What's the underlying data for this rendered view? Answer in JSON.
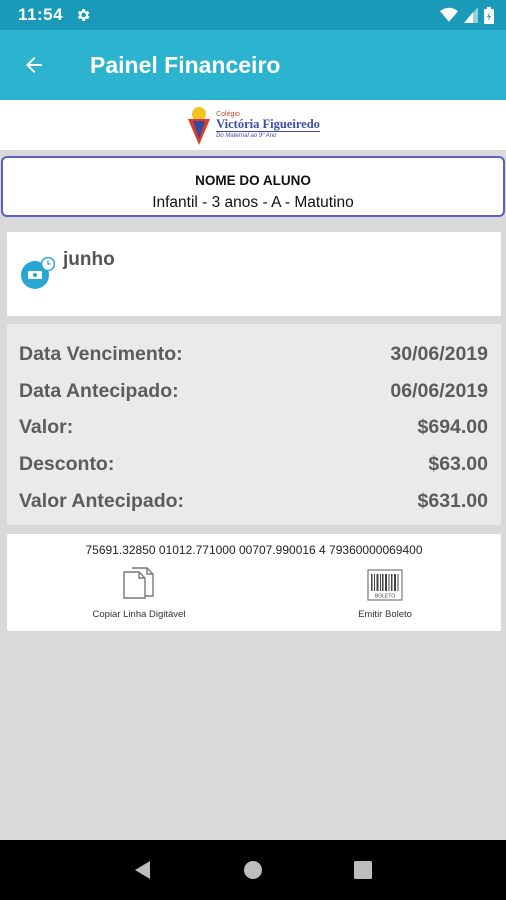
{
  "status_bar": {
    "time": "11:54",
    "icons": [
      "settings-gear-icon",
      "wifi-icon",
      "signal-icon",
      "battery-icon"
    ]
  },
  "app_bar": {
    "title": "Painel Financeiro",
    "back_icon": "arrow-left-icon",
    "color": "#2bb3cf"
  },
  "logo": {
    "small": "Colégio",
    "name": "Victória Figueiredo",
    "sub": "Do Maternal ao 9º Ano"
  },
  "student": {
    "name": "NOME DO ALUNO",
    "class": "Infantil - 3 anos - A - Matutino"
  },
  "month": {
    "label": "junho",
    "icon": "payment-clock-icon"
  },
  "details": [
    {
      "label": "Data Vencimento:",
      "value": "30/06/2019"
    },
    {
      "label": "Data Antecipado:",
      "value": "06/06/2019"
    },
    {
      "label": "Valor:",
      "value": "$694.00"
    },
    {
      "label": "Desconto:",
      "value": "$63.00"
    },
    {
      "label": "Valor Antecipado:",
      "value": "$631.00"
    }
  ],
  "boleto": {
    "digitable_line": "75691.32850 01012.771000 00707.990016 4 79360000069400",
    "copy_label": "Copiar Linha Digitável",
    "emit_label": "Emitir Boleto",
    "barcode_caption": "BOLETO"
  },
  "nav": {
    "icons": [
      "back-triangle-icon",
      "home-circle-icon",
      "recents-square-icon"
    ]
  }
}
